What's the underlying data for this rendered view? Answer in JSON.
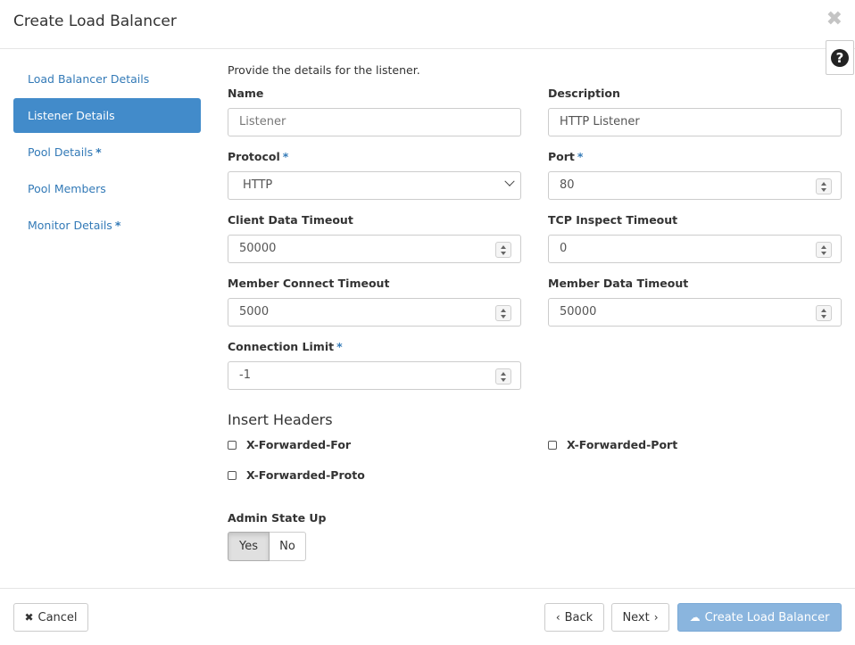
{
  "modal": {
    "title": "Create Load Balancer",
    "close_glyph": "✖",
    "help_glyph": "?"
  },
  "nav": {
    "items": [
      {
        "label": "Load Balancer Details",
        "required": false,
        "active": false
      },
      {
        "label": "Listener Details",
        "required": false,
        "active": true
      },
      {
        "label": "Pool Details",
        "required": true,
        "active": false
      },
      {
        "label": "Pool Members",
        "required": false,
        "active": false
      },
      {
        "label": "Monitor Details",
        "required": true,
        "active": false
      }
    ],
    "required_marker": "*"
  },
  "form": {
    "intro": "Provide the details for the listener.",
    "name": {
      "label": "Name",
      "placeholder": "Listener"
    },
    "description": {
      "label": "Description",
      "value": "HTTP Listener"
    },
    "protocol": {
      "label": "Protocol",
      "value": "HTTP"
    },
    "port": {
      "label": "Port",
      "value": "80"
    },
    "client_data_timeout": {
      "label": "Client Data Timeout",
      "value": "50000"
    },
    "tcp_inspect_timeout": {
      "label": "TCP Inspect Timeout",
      "value": "0"
    },
    "member_connect_timeout": {
      "label": "Member Connect Timeout",
      "value": "5000"
    },
    "member_data_timeout": {
      "label": "Member Data Timeout",
      "value": "50000"
    },
    "connection_limit": {
      "label": "Connection Limit",
      "value": "-1"
    },
    "required_marker": "*"
  },
  "headers": {
    "title": "Insert Headers",
    "x_forwarded_for": "X-Forwarded-For",
    "x_forwarded_port": "X-Forwarded-Port",
    "x_forwarded_proto": "X-Forwarded-Proto"
  },
  "admin_state": {
    "label": "Admin State Up",
    "yes": "Yes",
    "no": "No",
    "selected": "Yes"
  },
  "footer": {
    "cancel": "Cancel",
    "back": "Back",
    "next": "Next",
    "create": "Create Load Balancer",
    "cancel_icon": "✖",
    "back_icon": "‹",
    "next_icon": "›",
    "create_icon": "☁"
  },
  "colors": {
    "accent": "#428bca",
    "link": "#337ab7",
    "primary_disabled": "#8ab5de"
  }
}
